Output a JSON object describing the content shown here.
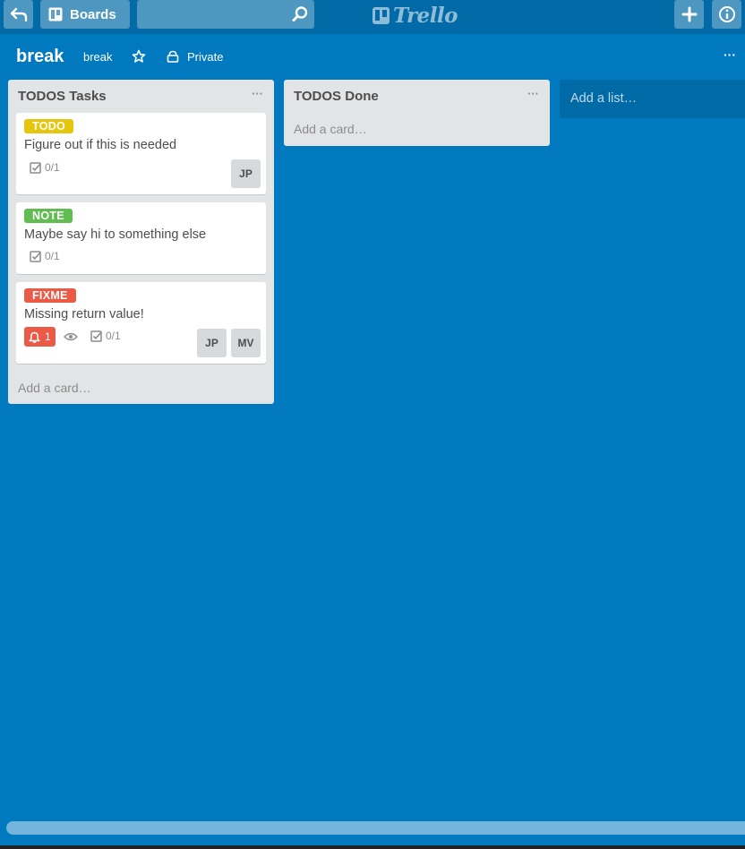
{
  "header": {
    "boards_label": "Boards",
    "search": {
      "value": "",
      "placeholder": ""
    },
    "logo_text": "Trello"
  },
  "board": {
    "title": "break",
    "team": "break",
    "privacy": "Private",
    "menu": "···"
  },
  "lists": [
    {
      "title": "TODOS Tasks",
      "menu": "···",
      "add_card": "Add a card…",
      "cards": [
        {
          "label": "TODO",
          "label_color": "#e6c60d",
          "title": "Figure out if this is needed",
          "checklist": "0/1",
          "members": [
            "JP"
          ]
        },
        {
          "label": "NOTE",
          "label_color": "#61bd4f",
          "title": "Maybe say hi to something else",
          "checklist": "0/1",
          "members": []
        },
        {
          "label": "FIXME",
          "label_color": "#eb5a46",
          "title": "Missing return value!",
          "notifications": "1",
          "checklist": "0/1",
          "members": [
            "JP",
            "MV"
          ]
        }
      ]
    },
    {
      "title": "TODOS Done",
      "menu": "···",
      "add_card": "Add a card…",
      "cards": []
    }
  ],
  "add_list": "Add a list…",
  "colors": {
    "board_bg": "#0079bf",
    "header_bg": "#026aa7",
    "list_bg": "#e2e4e6"
  }
}
